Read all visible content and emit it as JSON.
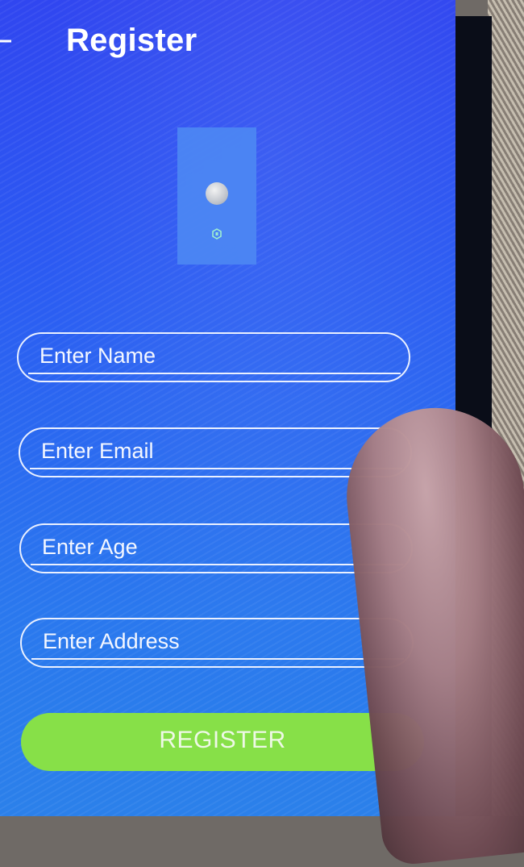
{
  "header": {
    "title": "Register",
    "back_icon": "arrow-left-icon"
  },
  "image_area": {
    "avatar_icon": "avatar-icon",
    "small_icon": "hexagon-icon"
  },
  "form": {
    "fields": [
      {
        "placeholder": "Enter Name"
      },
      {
        "placeholder": "Enter Email"
      },
      {
        "placeholder": "Enter Age"
      },
      {
        "placeholder": "Enter Address"
      }
    ],
    "submit_label": "REGISTER"
  },
  "colors": {
    "background": "#2b5cf2",
    "field_border": "#eaf0ff",
    "button": "#87e048"
  }
}
